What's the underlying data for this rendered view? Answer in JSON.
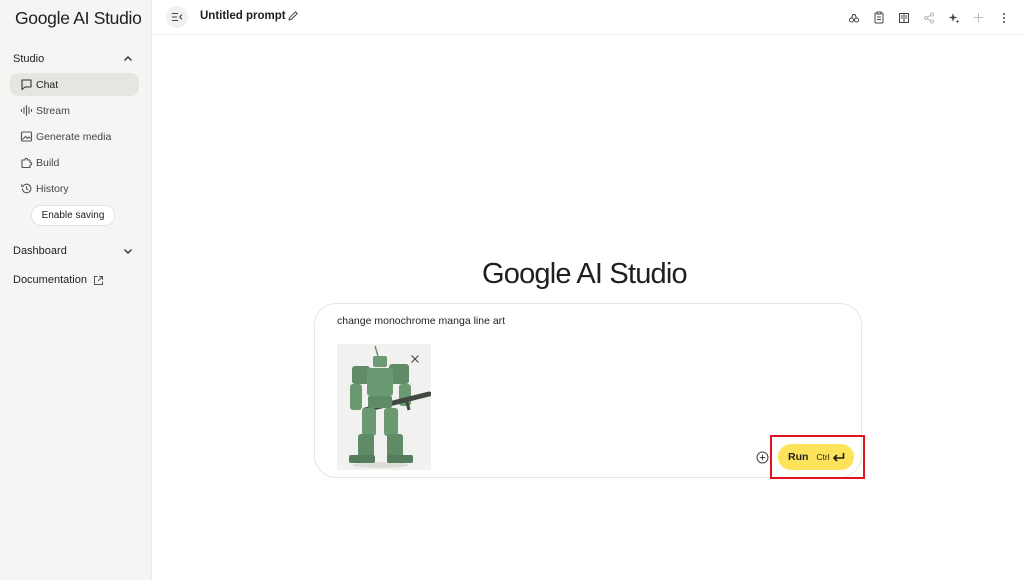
{
  "app": {
    "logo": "Google AI Studio"
  },
  "sidebar": {
    "studio_label": "Studio",
    "items": [
      {
        "label": "Chat",
        "icon": "chat-icon",
        "active": true
      },
      {
        "label": "Stream",
        "icon": "waveform-icon"
      },
      {
        "label": "Generate media",
        "icon": "image-icon"
      },
      {
        "label": "Build",
        "icon": "puzzle-icon"
      },
      {
        "label": "History",
        "icon": "history-icon"
      }
    ],
    "enable_saving": "Enable saving",
    "dashboard_label": "Dashboard",
    "documentation_label": "Documentation"
  },
  "header": {
    "title": "Untitled prompt",
    "actions": [
      "compare-icon",
      "clipboard-icon",
      "book-icon",
      "share-icon",
      "sparkle-icon",
      "add-icon",
      "more-icon"
    ]
  },
  "main": {
    "brand": "Google AI Studio",
    "prompt_text": "change monochrome manga line art",
    "attachment": "robot figure image",
    "run_label": "Run",
    "run_shortcut": "Ctrl"
  },
  "colors": {
    "run_button": "#fde35a",
    "highlight": "#e0131f",
    "sidebar_bg": "#f6f5f3"
  }
}
